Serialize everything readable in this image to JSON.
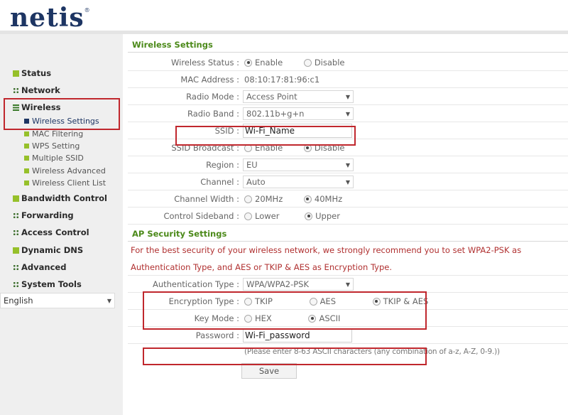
{
  "brand": {
    "logo": "netis",
    "reg": "®"
  },
  "sidebar": {
    "items": [
      {
        "label": "Status",
        "icon": "square-icon"
      },
      {
        "label": "Network",
        "icon": "dots-icon"
      },
      {
        "label": "Wireless",
        "icon": "bars-icon"
      },
      {
        "label": "Bandwidth Control",
        "icon": "square-icon"
      },
      {
        "label": "Forwarding",
        "icon": "dots-icon"
      },
      {
        "label": "Access Control",
        "icon": "dots-icon"
      },
      {
        "label": "Dynamic DNS",
        "icon": "square-icon"
      },
      {
        "label": "Advanced",
        "icon": "dots-icon"
      },
      {
        "label": "System Tools",
        "icon": "dots-icon"
      }
    ],
    "wireless_sub": [
      "Wireless Settings",
      "MAC Filtering",
      "WPS Setting",
      "Multiple SSID",
      "Wireless Advanced",
      "Wireless Client List"
    ],
    "language": "English"
  },
  "wireless": {
    "title": "Wireless Settings",
    "status_label": "Wireless Status :",
    "enable": "Enable",
    "disable": "Disable",
    "mac_label": "MAC Address :",
    "mac_value": "08:10:17:81:96:c1",
    "mode_label": "Radio Mode :",
    "mode_value": "Access Point",
    "band_label": "Radio Band :",
    "band_value": "802.11b+g+n",
    "ssid_label": "SSID :",
    "ssid_value": "Wi-Fi_Name",
    "broadcast_label": "SSID Broadcast :",
    "region_label": "Region :",
    "region_value": "EU",
    "channel_label": "Channel :",
    "channel_value": "Auto",
    "width_label": "Channel Width :",
    "width_20": "20MHz",
    "width_40": "40MHz",
    "sideband_label": "Control Sideband :",
    "lower": "Lower",
    "upper": "Upper"
  },
  "security": {
    "title": "AP Security Settings",
    "notice1": "For the best security of your wireless network, we strongly recommend you to set WPA2-PSK as",
    "notice2": "Authentication Type, and AES or TKIP & AES as Encryption Type.",
    "auth_label": "Authentication Type :",
    "auth_value": "WPA/WPA2-PSK",
    "enc_label": "Encryption Type :",
    "tkip": "TKIP",
    "aes": "AES",
    "tkip_aes": "TKIP & AES",
    "keymode_label": "Key Mode :",
    "hex": "HEX",
    "ascii": "ASCII",
    "password_label": "Password :",
    "password_value": "Wi-Fi_password",
    "hint": "(Please enter 8-63 ASCII characters (any combination of a-z, A-Z, 0-9.))",
    "save": "Save"
  },
  "colors": {
    "highlight": "#c0272d",
    "section": "#4c8a1a",
    "notice": "#b03030",
    "logo": "#1d3563"
  }
}
